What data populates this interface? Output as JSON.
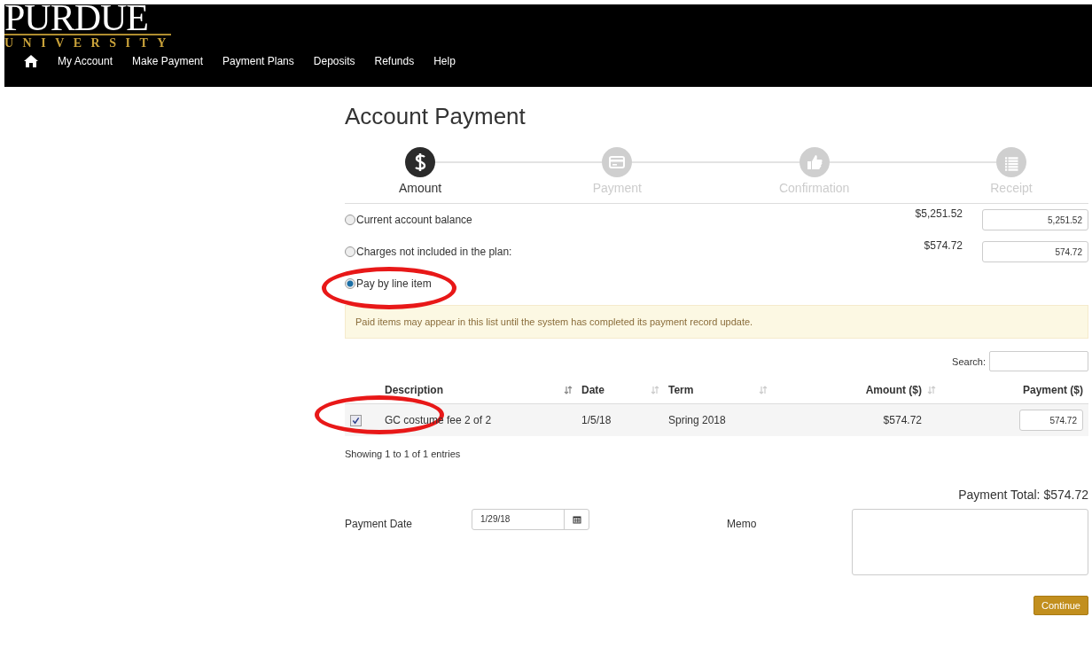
{
  "header": {
    "logo_wordmark": "PURDUE",
    "logo_subtitle": "UNIVERSITY",
    "nav": [
      {
        "label": "My Account"
      },
      {
        "label": "Make Payment"
      },
      {
        "label": "Payment Plans"
      },
      {
        "label": "Deposits"
      },
      {
        "label": "Refunds"
      },
      {
        "label": "Help"
      }
    ]
  },
  "page_title": "Account Payment",
  "steps": [
    {
      "label": "Amount",
      "selected": true
    },
    {
      "label": "Payment",
      "selected": false
    },
    {
      "label": "Confirmation",
      "selected": false
    },
    {
      "label": "Receipt",
      "selected": false
    }
  ],
  "options": [
    {
      "label": "Current account balance",
      "selected": false,
      "circled": false,
      "amount": "$5,251.52",
      "value": "5,251.52"
    },
    {
      "label": "Charges not included in the plan:",
      "selected": false,
      "circled": false,
      "amount": "$574.72",
      "value": "574.72"
    },
    {
      "label": "Pay by line item",
      "selected": true,
      "circled": true
    }
  ],
  "notice": "Paid items may appear in this list until the system has completed its payment record update.",
  "search": {
    "label": "Search:"
  },
  "table": {
    "columns": [
      "Description",
      "Date",
      "Term",
      "Amount ($)",
      "Payment ($)"
    ],
    "rows": [
      {
        "checked": true,
        "circled": true,
        "description": "GC costume fee 2 of 2",
        "date": "1/5/18",
        "term": "Spring 2018",
        "amount": "$574.72",
        "payment": "574.72"
      }
    ]
  },
  "entries_info": "Showing 1 to 1 of 1 entries",
  "payment_total": "Payment Total: $574.72",
  "payment_date": {
    "label": "Payment Date",
    "value": "1/29/18"
  },
  "memo": {
    "label": "Memo"
  },
  "continue_button": "Continue"
}
